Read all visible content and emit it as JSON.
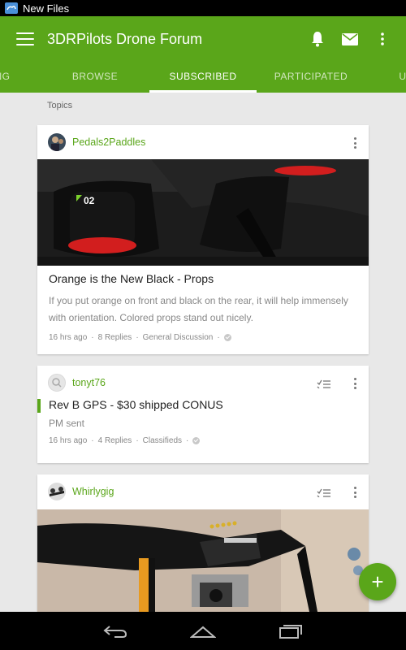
{
  "status_bar": {
    "notification_text": "New Files"
  },
  "app_bar": {
    "title": "3DRPilots Drone Forum",
    "actions": [
      "bell-icon",
      "mail-icon",
      "more-vert-icon"
    ]
  },
  "tabs": [
    {
      "label": "NG"
    },
    {
      "label": "BROWSE"
    },
    {
      "label": "SUBSCRIBED",
      "active": true
    },
    {
      "label": "PARTICIPATED"
    },
    {
      "label": "U"
    }
  ],
  "section_label": "Topics",
  "topics": [
    {
      "author": "Pedals2Paddles",
      "title": "Orange is the New Black - Props",
      "snippet": "If you put orange on front and black on the rear, it will help immensely with orientation. Colored props stand out nicely.",
      "time": "16 hrs ago",
      "replies": "8 Replies",
      "forum": "General Discussion",
      "image_overlay_text": "02"
    },
    {
      "author": "tonyt76",
      "title": "Rev B GPS - $30 shipped CONUS",
      "snippet": "PM sent",
      "time": "16 hrs ago",
      "replies": "4 Replies",
      "forum": "Classifieds"
    },
    {
      "author": "Whirlygig"
    }
  ],
  "fab": {
    "label": "+"
  },
  "colors": {
    "accent": "#5aa61a",
    "background": "#e8e8e8"
  }
}
